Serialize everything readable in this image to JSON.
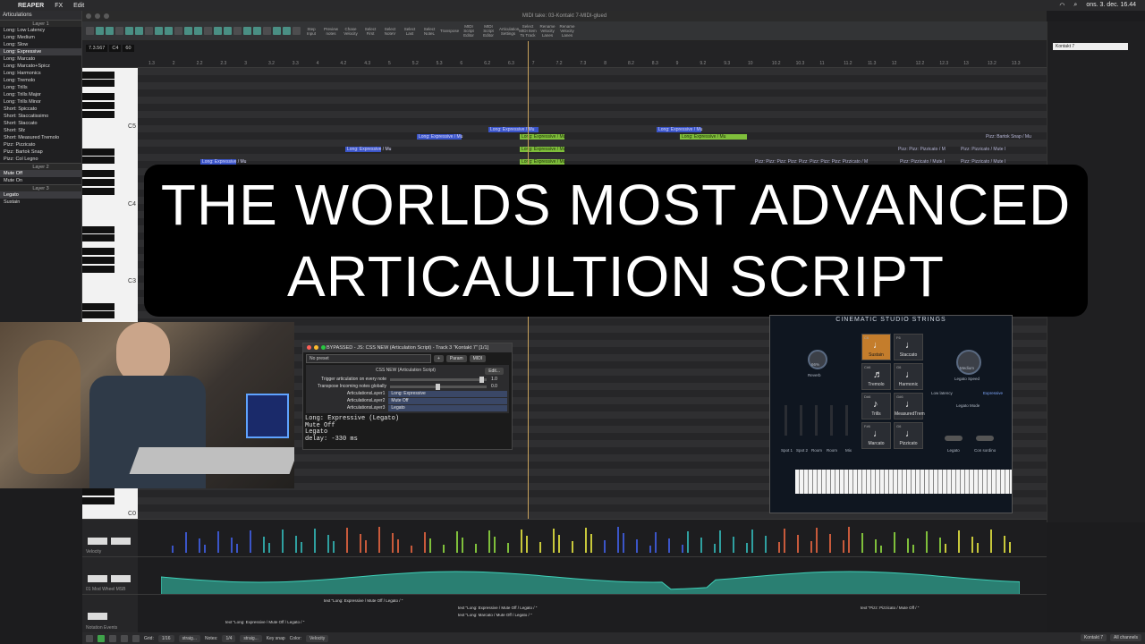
{
  "menubar": {
    "app": "REAPER",
    "items": [
      "FX",
      "Edit"
    ],
    "datetime": "ons. 3. dec. 16.44"
  },
  "window_title": "MIDI take: 03-Kontakt 7-MIDI-glued",
  "toolbar_labels": [
    "Step Input",
    "Preview notes",
    "Chase Velocity",
    "Select First",
    "Select NoteV",
    "Select Last",
    "Select NoteL",
    "Transpose",
    "MIDI Script Editor",
    "MIDI Script Editor",
    "Articulation Settings",
    "Select MIDI Item To Track",
    "Rename Velocity Lanes",
    "Rename Velocity Lanes"
  ],
  "articulations": {
    "title": "Articulations",
    "layer1": "Layer 1",
    "layer1_items": [
      "Long: Low Latency",
      "Long: Medium",
      "Long: Slow",
      "Long: Expressive",
      "Long: Marcato",
      "Long: Marcato+Spicz",
      "Long: Harmonics",
      "Long: Tremolo",
      "Long: Trills",
      "Long: Trills Major",
      "Long: Trills Minor",
      "Short: Spiccato",
      "Short: Staccatissimo",
      "Short: Staccato",
      "Short: Sfz",
      "Short: Measured Tremolo",
      "Pizz: Pizzicato",
      "Pizz: Bartok Snap",
      "Pizz: Col Legno"
    ],
    "layer2": "Layer 2",
    "layer2_items": [
      "Mute Off",
      "Mute On"
    ],
    "layer3": "Layer 3",
    "layer3_items": [
      "Legato",
      "Sustain"
    ]
  },
  "position": {
    "time": "7.3.567",
    "note": "C4",
    "velocity": "60"
  },
  "ruler_ticks": [
    "1.3",
    "2",
    "2.2",
    "2.3",
    "3",
    "3.2",
    "3.3",
    "4",
    "4.2",
    "4.3",
    "5",
    "5.2",
    "5.3",
    "6",
    "6.2",
    "6.3",
    "7",
    "7.2",
    "7.3",
    "8",
    "8.2",
    "8.3",
    "9",
    "9.2",
    "9.3",
    "10",
    "10.2",
    "10.3",
    "11",
    "11.2",
    "11.3",
    "12",
    "12.2",
    "12.3",
    "13",
    "13.2",
    "13.3"
  ],
  "piano_labels": {
    "c5": "C5",
    "c4": "C4",
    "c3": "C3",
    "c0": "C0"
  },
  "notes": [
    "Long: Expressive / Mu",
    "Long: Expressive / Mu",
    "Long: Expressive / Mu",
    "Long: Expressive / Mu",
    "Long: Expressive / Mu",
    "Long: Expressive / Mu",
    "Long: Expressive / Mu",
    "Long: Expressive / Mu",
    "Long: Expressive / Mu",
    "Pizz: Bartok Snap / Mu",
    "Pizz: Pizz: Pizzicato / M",
    "Pizz: Pizzicato / Mute I",
    "Pizz: Pizz: Pizz: Pizz: Pizz: Pizz: Pizz: Pizz: Pizzicato / M",
    "Pizz: Pizzicato / Mute I",
    "Pizz: Pizzicato / Mute I"
  ],
  "banner": {
    "line1": "THE WORLDS MOST ADVANCED",
    "line2": "ARTICAULTION SCRIPT"
  },
  "jsfx": {
    "title": "BYPASSED - JS: CSS NEW (Articulation Script) - Track 3 \"Kontakt 7\" [1/1]",
    "preset": "No preset",
    "plus": "+",
    "param": "Param",
    "midi": "MIDI",
    "plugin_name": "CSS NEW (Articulation Script)",
    "edit": "Edit...",
    "sliders": [
      {
        "label": "Trigger articulation on every note",
        "value": "1.0"
      },
      {
        "label": "Transpose Incoming notes globally",
        "value": "0.0"
      }
    ],
    "selectors": [
      {
        "label": "ArticulationsLayer1",
        "value": "Long: Expressive"
      },
      {
        "label": "ArticulationsLayer2",
        "value": "Mute Off"
      },
      {
        "label": "ArticulationsLayer3",
        "value": "Legato"
      }
    ],
    "output": [
      "Long: Expressive (Legato)",
      "Mute Off",
      "Legato",
      "delay: -330 ms"
    ]
  },
  "kontakt": {
    "header": "CINEMATIC STUDIO STRINGS",
    "reverb": "Reverb",
    "reverb_val": "66%",
    "legato_speed": "Legato Speed",
    "legato_speed_val": "Medium",
    "low_latency": "Low latency",
    "expressive": "Expressive",
    "legato_mode": "Legato Mode",
    "legato": "Legato",
    "con_sordino": "Con sordino",
    "mix_labels": [
      "Spot 1",
      "Spot 2",
      "Room",
      "Room",
      "Mix"
    ],
    "buttons": [
      {
        "key": "C6",
        "label": "Sustain",
        "glyph": "♩",
        "on": true
      },
      {
        "key": "F6",
        "label": "Staccato",
        "glyph": "♩",
        "on": false
      },
      {
        "key": "C#6",
        "label": "Tremolo",
        "glyph": "♬",
        "on": false
      },
      {
        "key": "G6",
        "label": "Harmonic",
        "glyph": "♩",
        "on": false
      },
      {
        "key": "D#6",
        "label": "Trills",
        "glyph": "♪",
        "on": false
      },
      {
        "key": "G#6",
        "label": "MeasuredTrem",
        "glyph": "♩",
        "on": false
      },
      {
        "key": "F#6",
        "label": "Marcato",
        "glyph": "♩",
        "on": false
      },
      {
        "key": "G6",
        "label": "Pizzicato",
        "glyph": "♩",
        "on": false
      }
    ]
  },
  "right_panel": {
    "fx": "Kontakt 7"
  },
  "lanes": {
    "velocity": "Velocity",
    "modwheel": "01 Mod Wheel MSB",
    "notation": "Notation Events"
  },
  "text_events": [
    "text \"Long: Expressive / Mute Off / Legato / \"",
    "text \"Long: Expressive / Mute Off / Legato / \"",
    "text \"Long: Marcato / Mute Off / Legato / \"",
    "text \"Pizz: Pizzicato / Mute Off / \"",
    "text \"Long: Expressive / Mute Off / Legato / \""
  ],
  "bottombar": {
    "grid_label": "Grid:",
    "grid_val": "1/16",
    "straight": "straig...",
    "notes_label": "Notes:",
    "notes_val": "1/4",
    "straight2": "straig...",
    "keymap": "Key snap",
    "color_label": "Color:",
    "color_val": "Velocity",
    "fx": "Kontakt 7",
    "channels": "All channels"
  },
  "colors": {
    "teal": "#4a8f84",
    "note_blue": "#3b55c8",
    "note_green": "#7fbf3b",
    "orange": "#c47d2c",
    "playhead": "#c8a25c"
  }
}
